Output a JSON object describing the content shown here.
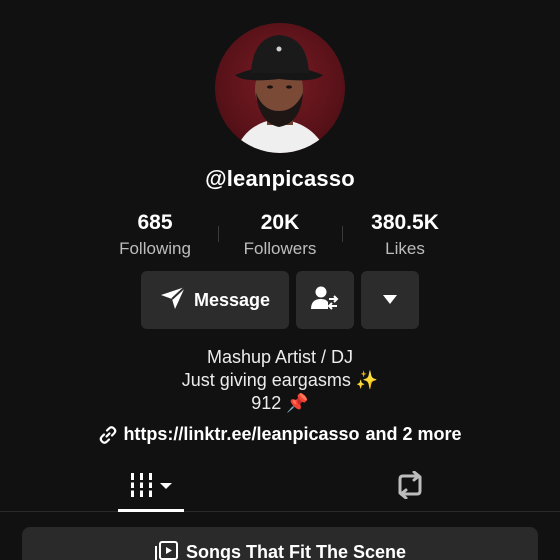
{
  "profile": {
    "username": "@leanpicasso"
  },
  "stats": [
    {
      "value": "685",
      "label": "Following"
    },
    {
      "value": "20K",
      "label": "Followers"
    },
    {
      "value": "380.5K",
      "label": "Likes"
    }
  ],
  "actions": {
    "message_label": "Message",
    "message_icon": "send-icon",
    "follow_icon": "friend-swap-icon",
    "more_icon": "caret-down-icon"
  },
  "bio": {
    "line1": "Mashup Artist / DJ",
    "line2": "Just giving eargasms ✨",
    "line3": "912 📌"
  },
  "link": {
    "url": "https://linktr.ee/leanpicasso",
    "more": "and 2 more"
  },
  "tabs": [
    {
      "icon": "grid-icon",
      "active": true
    },
    {
      "icon": "repost-icon",
      "active": false
    }
  ],
  "section": {
    "label": "Songs That Fit The Scene"
  },
  "colors": {
    "background": "#111111",
    "button": "#2c2c2c",
    "muted_text": "#bdbdbd",
    "avatar_bg": "#5a1219"
  }
}
